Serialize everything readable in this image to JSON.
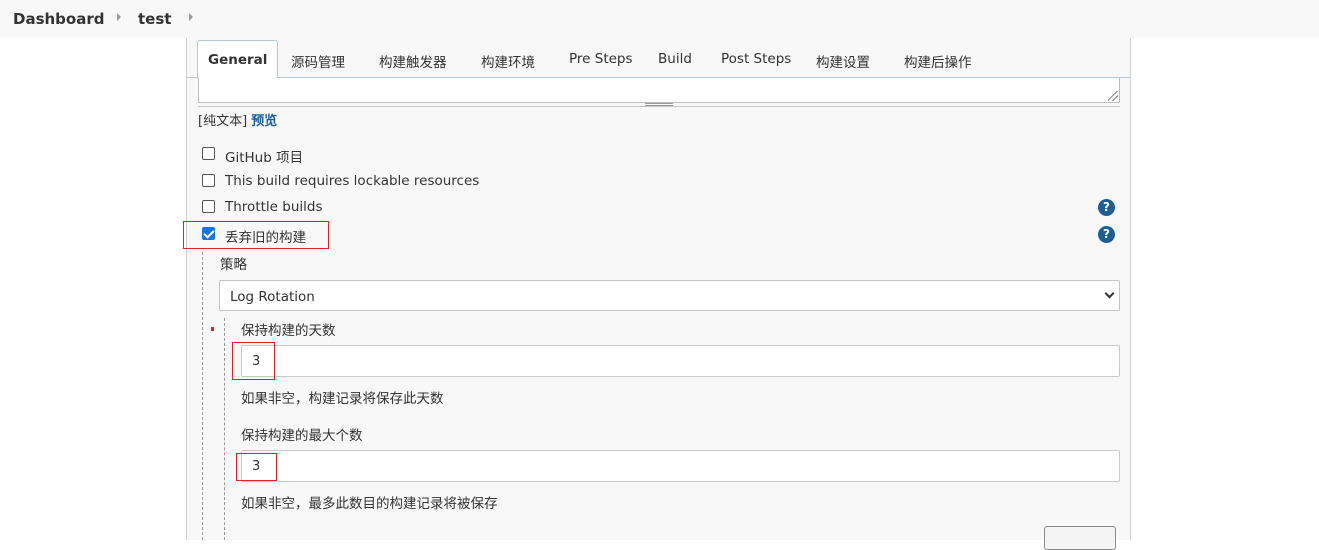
{
  "breadcrumb": {
    "dashboard": "Dashboard",
    "project": "test"
  },
  "tabs": [
    {
      "label": "General",
      "active": true
    },
    {
      "label": "源码管理"
    },
    {
      "label": "构建触发器"
    },
    {
      "label": "构建环境"
    },
    {
      "label": "Pre Steps"
    },
    {
      "label": "Build"
    },
    {
      "label": "Post Steps"
    },
    {
      "label": "构建设置"
    },
    {
      "label": "构建后操作"
    }
  ],
  "description": {
    "format_label": "[纯文本]",
    "preview_label": "预览"
  },
  "options": {
    "github_project": {
      "label": "GitHub 项目",
      "checked": false
    },
    "lockable_resources": {
      "label": "This build requires lockable resources",
      "checked": false
    },
    "throttle_builds": {
      "label": "Throttle builds",
      "checked": false
    },
    "discard_old_builds": {
      "label": "丢弃旧的构建",
      "checked": true
    }
  },
  "strategy": {
    "label": "策略",
    "selected": "Log Rotation"
  },
  "days_to_keep": {
    "label": "保持构建的天数",
    "value": "3",
    "hint": "如果非空，构建记录将保存此天数"
  },
  "max_builds": {
    "label": "保持构建的最大个数",
    "value": "3",
    "hint": "如果非空，最多此数目的构建记录将被保存"
  },
  "help_icon_glyph": "?",
  "colors": {
    "accent": "#1a73e8",
    "help": "#1d5f95",
    "highlight": "#d9262b",
    "link": "#1b5e9e"
  }
}
